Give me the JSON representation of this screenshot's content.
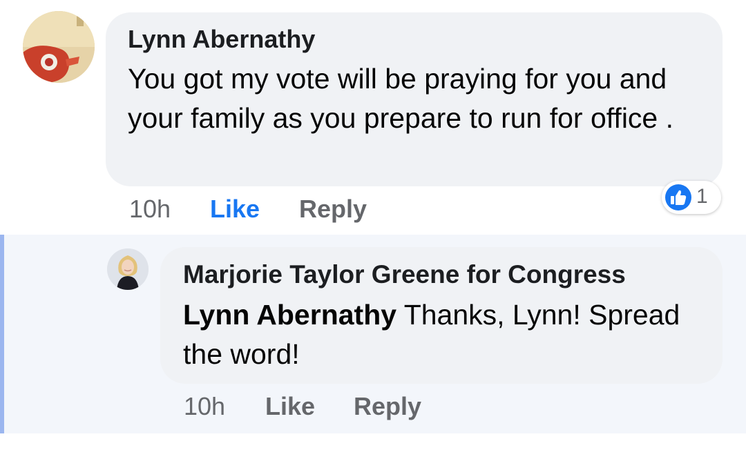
{
  "comment": {
    "author": "Lynn Abernathy",
    "text": "You got my vote will be praying for you and your family as you prepare to run for office .",
    "time": "10h",
    "like_label": "Like",
    "reply_label": "Reply",
    "reaction_count": "1",
    "like_color": "#1877f2"
  },
  "reply": {
    "author": "Marjorie Taylor Greene for Congress",
    "mention": "Lynn Abernathy",
    "text": " Thanks, Lynn! Spread the word!",
    "time": "10h",
    "like_label": "Like",
    "reply_label": "Reply"
  }
}
